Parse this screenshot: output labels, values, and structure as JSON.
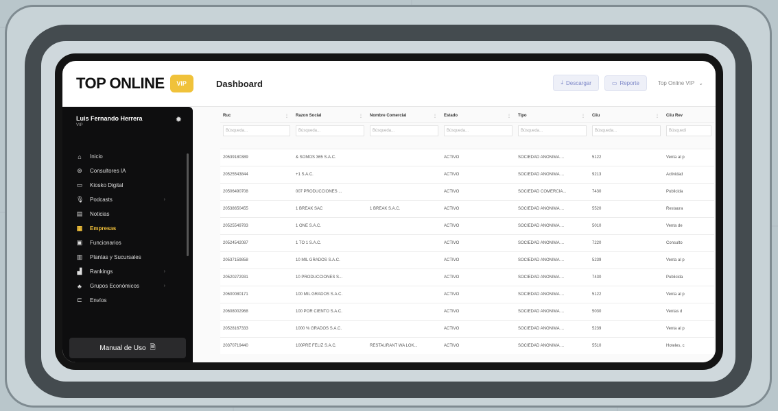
{
  "app": {
    "logo_text": "TOP ONLINE",
    "logo_badge": "VIP",
    "page_title": "Dashboard"
  },
  "toolbar": {
    "download_label": "Descargar",
    "report_label": "Reporte",
    "plan_select": "Top Online VIP"
  },
  "user": {
    "name": "Luis Fernando Herrera",
    "role": "VIP"
  },
  "sidebar": {
    "items": [
      {
        "label": "Inicio",
        "icon": "home-icon"
      },
      {
        "label": "Consultores IA",
        "icon": "ai-icon"
      },
      {
        "label": "Kiosko Digital",
        "icon": "kiosk-icon"
      },
      {
        "label": "Podcasts",
        "icon": "microphone-icon"
      },
      {
        "label": "Noticias",
        "icon": "news-icon"
      },
      {
        "label": "Empresas",
        "icon": "building-icon"
      },
      {
        "label": "Funcionarios",
        "icon": "people-icon"
      },
      {
        "label": "Plantas y Sucursales",
        "icon": "factory-icon"
      },
      {
        "label": "Rankings",
        "icon": "chart-icon"
      },
      {
        "label": "Grupos Económicos",
        "icon": "group-icon"
      },
      {
        "label": "Envíos",
        "icon": "send-icon"
      }
    ],
    "active": "Empresas",
    "manual_label": "Manual de Uso"
  },
  "table": {
    "columns": [
      "Ruc",
      "Razon Social",
      "Nombre Comercial",
      "Estado",
      "Tipo",
      "Ciiu",
      "Ciiu Rev"
    ],
    "filter_placeholders": [
      "Búsqueda...",
      "Búsqueda...",
      "Búsqueda...",
      "Búsqueda...",
      "Búsqueda...",
      "Búsqueda...",
      "Búsquedi"
    ],
    "rows": [
      [
        "20539180389",
        "& SOMOS 365 S.A.C.",
        "",
        "ACTIVO",
        "SOCIEDAD ANONIMA ...",
        "5122",
        "Venta al p"
      ],
      [
        "20525543844",
        "+1 S.A.C.",
        "",
        "ACTIVO",
        "SOCIEDAD ANONIMA ...",
        "9213",
        "Actividad"
      ],
      [
        "20506490708",
        "007 PRODUCCIONES ...",
        "",
        "ACTIVO",
        "SOCIEDAD COMERCIA...",
        "7430",
        "Publicida"
      ],
      [
        "20538650455",
        "1 BREAK SAC",
        "1 BREAK S.A.C.",
        "ACTIVO",
        "SOCIEDAD ANONIMA ...",
        "5520",
        "Restaura"
      ],
      [
        "20525549783",
        "1 ONE S.A.C.",
        "",
        "ACTIVO",
        "SOCIEDAD ANONIMA ...",
        "5010",
        "Venta de"
      ],
      [
        "20524542087",
        "1 TO 1 S.A.C.",
        "",
        "ACTIVO",
        "SOCIEDAD ANONIMA ...",
        "7220",
        "Consulto"
      ],
      [
        "20537159858",
        "10 MIL GRADOS S.A.C.",
        "",
        "ACTIVO",
        "SOCIEDAD ANONIMA ...",
        "5239",
        "Venta al p"
      ],
      [
        "20520272931",
        "10 PRODUCCIONES S...",
        "",
        "ACTIVO",
        "SOCIEDAD ANONIMA ...",
        "7430",
        "Publicida"
      ],
      [
        "20600080171",
        "100 MIL GRADOS S.A.C.",
        "",
        "ACTIVO",
        "SOCIEDAD ANONIMA ...",
        "5122",
        "Venta al p"
      ],
      [
        "20608002968",
        "100 POR CIENTO S.A.C.",
        "",
        "ACTIVO",
        "SOCIEDAD ANONIMA ...",
        "5030",
        "Ventas d"
      ],
      [
        "20528167333",
        "1000 % GRADOS S.A.C.",
        "",
        "ACTIVO",
        "SOCIEDAD ANONIMA ...",
        "5239",
        "Venta al p"
      ],
      [
        "20370719440",
        "100PRE FELIZ S.A.C.",
        "RESTAURANT WA LOK...",
        "ACTIVO",
        "SOCIEDAD ANONIMA ...",
        "5510",
        "Hoteles, c"
      ]
    ]
  },
  "colors": {
    "accent": "#f3c23b",
    "sidebar_bg": "#0e0e0f",
    "button_text": "#7c86c7"
  }
}
